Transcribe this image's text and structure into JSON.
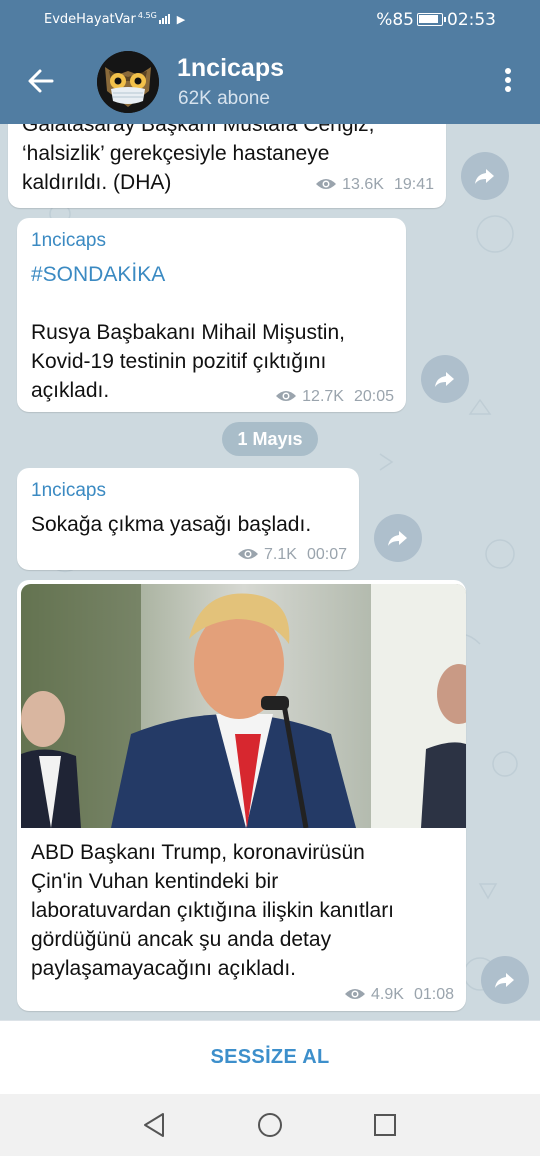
{
  "status_bar": {
    "carrier": "EvdeHayatVar",
    "network": "4.5G",
    "battery": "%85",
    "time": "02:53"
  },
  "header": {
    "channel_name": "1ncicaps",
    "subscribers": "62K abone",
    "back_icon": "arrow-left-icon",
    "menu_icon": "more-vertical-icon",
    "avatar_desc": "owl-with-face-mask-avatar"
  },
  "messages": [
    {
      "text_lines": [
        "Galatasaray Başkanı Mustafa Cengiz,",
        "‘halsizlik’ gerekçesiyle hastaneye",
        "kaldırıldı. (DHA)"
      ],
      "views": "13.6K",
      "time": "19:41"
    },
    {
      "sender": "1ncicaps",
      "hashtag": "#SONDAKİKA",
      "text_lines": [
        "Rusya Başbakanı Mihail Mişustin,",
        "Kovid-19 testinin pozitif çıktığını",
        "açıkladı."
      ],
      "views": "12.7K",
      "time": "20:05"
    },
    {
      "sender": "1ncicaps",
      "text_lines": [
        "Sokağa çıkma yasağı başladı."
      ],
      "views": "7.1K",
      "time": "00:07"
    },
    {
      "text_lines": [
        "ABD Başkanı Trump, koronavirüsün",
        "Çin'in Vuhan kentindeki bir",
        "laboratuvardan çıktığına ilişkin kanıtları",
        "gördüğünü ancak şu anda detay",
        "paylaşamayacağını açıkladı."
      ],
      "views": "4.9K",
      "time": "01:08"
    }
  ],
  "date_separator": "1 Mayıs",
  "bottom": {
    "mute_label": "SESSİZE AL"
  },
  "colors": {
    "header": "#517da2",
    "chat_bg": "#cdd9df",
    "link": "#3b8ac2",
    "mute": "#3d8fcb"
  }
}
